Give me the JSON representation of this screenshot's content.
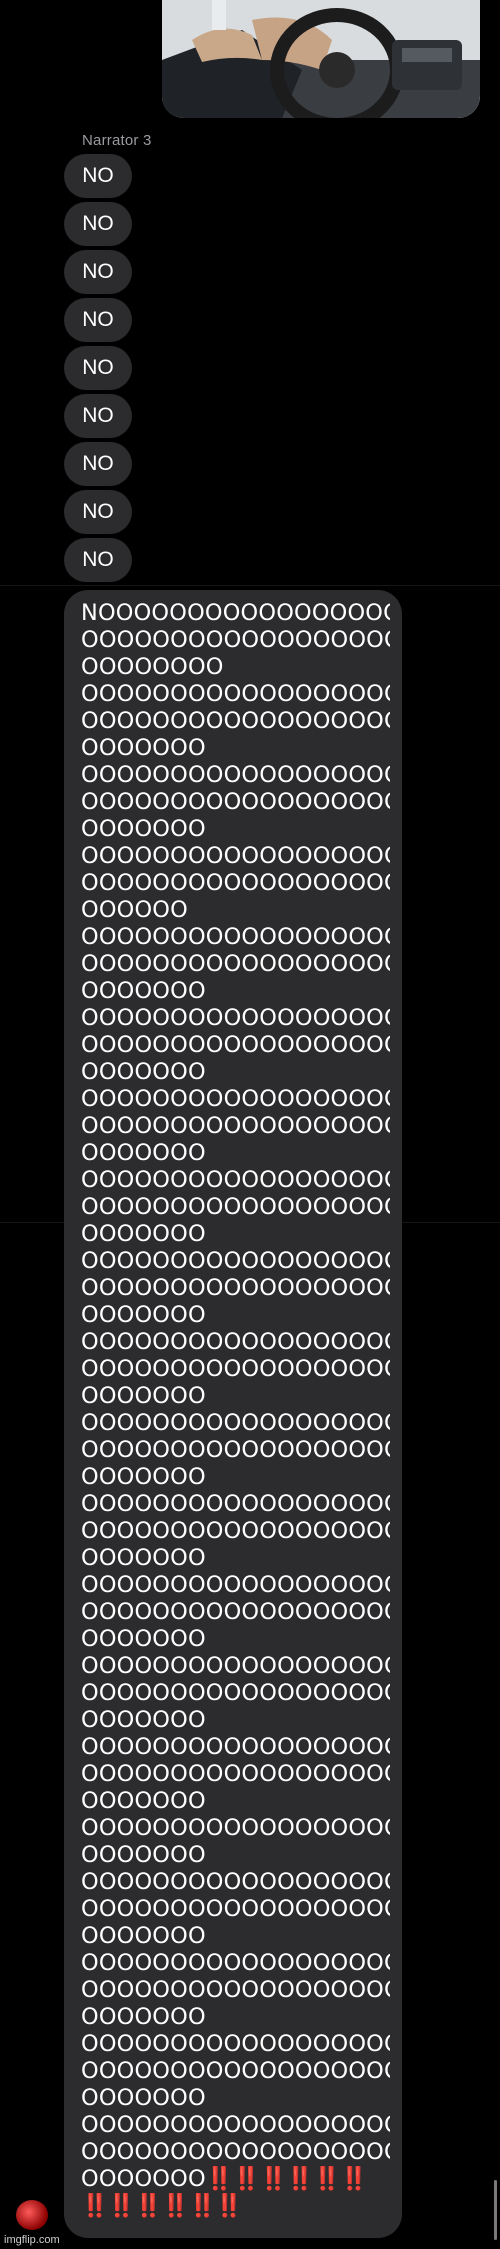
{
  "chat": {
    "sender_name": "Narrator 3",
    "short_messages": [
      "NO",
      "NO",
      "NO",
      "NO",
      "NO",
      "NO",
      "NO",
      "NO",
      "NO"
    ],
    "long_message_lines": [
      "NOOOOOOOOOOOOOOOOOO",
      "OOOOOOOOOOOOOOOOOOO",
      "OOOOOOOO",
      "OOOOOOOOOOOOOOOOOOO",
      "OOOOOOOOOOOOOOOOOOO",
      "OOOOOOO",
      "OOOOOOOOOOOOOOOOOOO",
      "OOOOOOOOOOOOOOOOOOO",
      "OOOOOOO",
      "OOOOOOOOOOOOOOOOOOO",
      "OOOOOOOOOOOOOOOOOOO",
      "OOOOOO",
      "OOOOOOOOOOOOOOOOOOO",
      "OOOOOOOOOOOOOOOOOOO",
      "OOOOOOO",
      "OOOOOOOOOOOOOOOOOOO",
      "OOOOOOOOOOOOOOOOOOO",
      "OOOOOOO",
      "OOOOOOOOOOOOOOOOOOO",
      "OOOOOOOOOOOOOOOOOOO",
      "OOOOOOO",
      "OOOOOOOOOOOOOOOOOOO",
      "OOOOOOOOOOOOOOOOOOO",
      "OOOOOOO",
      "OOOOOOOOOOOOOOOOOOO",
      "OOOOOOOOOOOOOOOOOOO",
      "OOOOOOO",
      "OOOOOOOOOOOOOOOOOOO",
      "OOOOOOOOOOOOOOOOOOO",
      "OOOOOOO",
      "OOOOOOOOOOOOOOOOOOO",
      "OOOOOOOOOOOOOOOOOOO",
      "OOOOOOO",
      "OOOOOOOOOOOOOOOOOOO",
      "OOOOOOOOOOOOOOOOOOO",
      "OOOOOOO",
      "OOOOOOOOOOOOOOOOOOO",
      "OOOOOOOOOOOOOOOOOOO",
      "OOOOOOO",
      "OOOOOOOOOOOOOOOOOOO",
      "OOOOOOOOOOOOOOOOOOO",
      "OOOOOOO",
      "OOOOOOOOOOOOOOOOOOO",
      "OOOOOOOOOOOOOOOOOOO",
      "OOOOOOO",
      "OOOOOOOOOOOOOOOOOOO",
      "OOOOOOO",
      "OOOOOOOOOOOOOOOOOOO",
      "OOOOOOOOOOOOOOOOOOO",
      "OOOOOOO",
      "OOOOOOOOOOOOOOOOOOO",
      "OOOOOOOOOOOOOOOOOOO",
      "OOOOOOO",
      "OOOOOOOOOOOOOOOOOOO",
      "OOOOOOOOOOOOOOOOOOO",
      "OOOOOOO",
      "OOOOOOOOOOOOOOOOOOO",
      "OOOOOOOOOOOOOOOOOOO"
    ],
    "long_message_tail_text": "OOOOOOO",
    "long_message_tail_bangs": "‼️‼️‼️‼️‼️‼️",
    "long_message_final_bangs": "‼️‼️‼️‼️‼️‼️"
  },
  "watermark": {
    "text": "imgflip.com"
  },
  "colors": {
    "background": "#000000",
    "bubble": "#2c2c2e",
    "sender_name": "#9a9a9f",
    "exclamation": "#e8231a"
  }
}
